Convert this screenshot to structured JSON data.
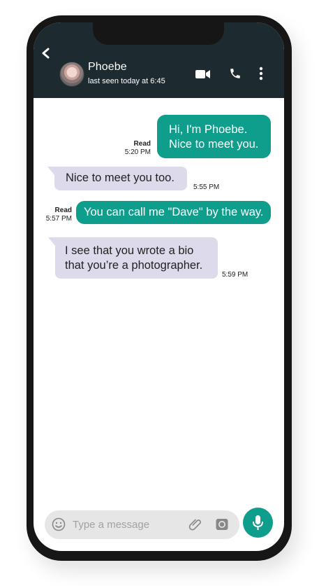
{
  "header": {
    "contact_name": "Phoebe",
    "last_seen": "last seen today at 6:45",
    "icons": [
      "back-icon",
      "video-call-icon",
      "phone-call-icon",
      "more-options-icon"
    ]
  },
  "messages": [
    {
      "direction": "outgoing",
      "text": "Hi, I'm Phoebe. Nice to meet you.",
      "status": "Read",
      "time": "5:20 PM"
    },
    {
      "direction": "incoming",
      "text": "Nice to meet you too.",
      "time": "5:55 PM"
    },
    {
      "direction": "outgoing",
      "text": "You can call me \"Dave\" by the way.",
      "status": "Read",
      "time": "5:57 PM"
    },
    {
      "direction": "incoming",
      "text": "I see that you wrote a bio that you’re a photographer.",
      "time": "5:59 PM"
    }
  ],
  "composer": {
    "placeholder": "Type a message",
    "value": "",
    "icons": [
      "emoji-icon",
      "attachment-icon",
      "camera-icon",
      "microphone-icon"
    ]
  },
  "colors": {
    "header_bg": "#1d2a2f",
    "outgoing_bubble": "#0f9e8c",
    "incoming_bubble": "#dddbeb",
    "mic_button": "#0f9e8c",
    "phone_frame": "#161616"
  }
}
